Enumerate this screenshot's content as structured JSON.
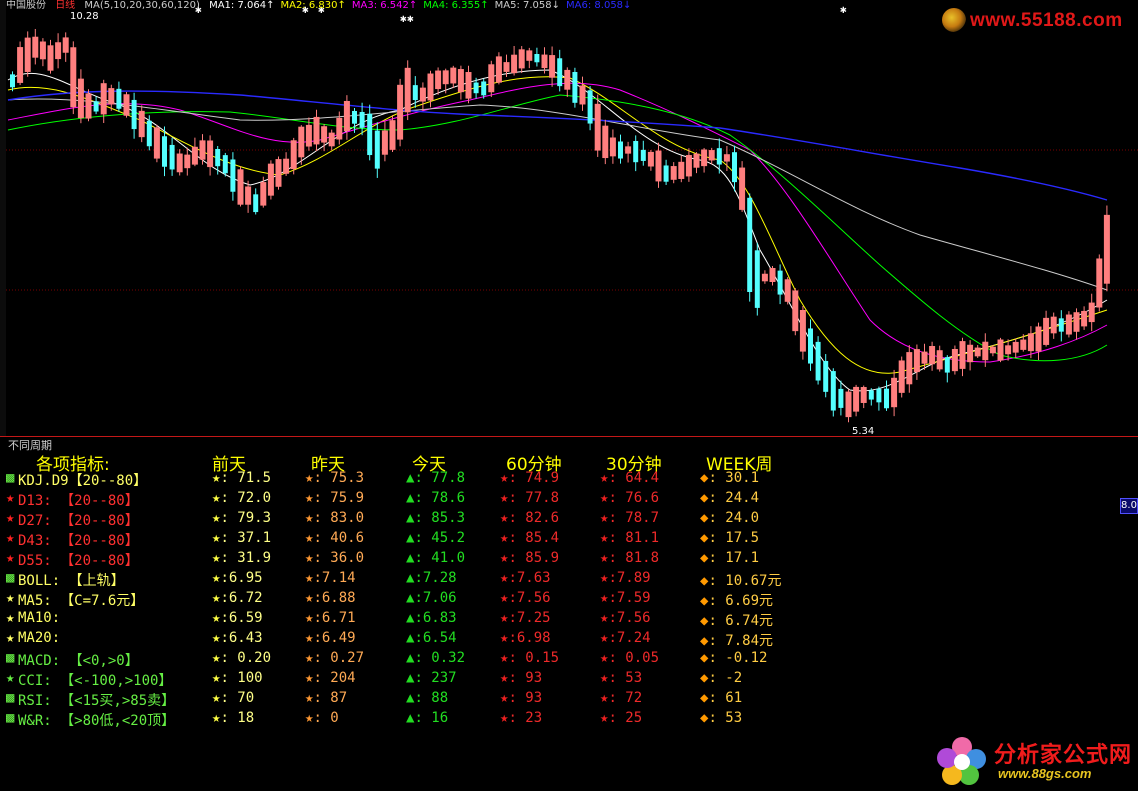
{
  "chart": {
    "stock_name": "中国股份",
    "period": "日线",
    "ma_header": "MA(5,10,20,30,60,120)",
    "ma_values": [
      {
        "label": "MA1: 7.064↑",
        "color": "#ffffff"
      },
      {
        "label": "MA2: 6.830↑",
        "color": "#ffff00"
      },
      {
        "label": "MA3: 6.542↑",
        "color": "#ff00ff"
      },
      {
        "label": "MA4: 6.355↑",
        "color": "#00ff00"
      },
      {
        "label": "MA5: 7.058↓",
        "color": "#cccccc"
      },
      {
        "label": "MA6: 8.058↓",
        "color": "#2a2aff"
      }
    ],
    "high_label": "10.28",
    "low_label": "5.34",
    "colors": {
      "up": "#ff7f7f",
      "down": "#54ffff",
      "grid": "#7a0000"
    }
  },
  "chart_data": {
    "type": "candlestick",
    "ylim": [
      5.0,
      10.5
    ],
    "series": [
      {
        "name": "MA1",
        "color": "#ffffff"
      },
      {
        "name": "MA2",
        "color": "#ffff00"
      },
      {
        "name": "MA3",
        "color": "#ff00ff"
      },
      {
        "name": "MA4",
        "color": "#00ff00"
      },
      {
        "name": "MA5",
        "color": "#cccccc"
      },
      {
        "name": "MA6",
        "color": "#2a2aff"
      }
    ],
    "annotations": [
      "10.28",
      "5.34"
    ]
  },
  "watermarks": {
    "top": "www.55188.com",
    "bottom_cn": "分析家公式网",
    "bottom_url": "www.88gs.com"
  },
  "bottom_pane": {
    "label": "不同周期",
    "axis_tag": "8.0"
  },
  "table": {
    "headers": [
      "各项指标:",
      "前天",
      "昨天",
      "今天",
      "60分钟",
      "30分钟",
      "WEEK周"
    ],
    "rows": [
      {
        "icon": "▩",
        "icon_color": "#66ee44",
        "name": "KDJ.D9【20--80】",
        "name_color": "#ffff66",
        "cells": [
          "★: 71.5",
          "★: 75.3",
          "▲: 77.8",
          "★: 74.9",
          "★: 64.4",
          "◆: 30.1"
        ]
      },
      {
        "icon": "★",
        "icon_color": "#ff2020",
        "name": "D13: 【20--80】",
        "name_color": "#ff3030",
        "cells": [
          "★: 72.0",
          "★: 75.9",
          "▲: 78.6",
          "★: 77.8",
          "★: 76.6",
          "◆: 24.4"
        ]
      },
      {
        "icon": "★",
        "icon_color": "#ff2020",
        "name": "D27: 【20--80】",
        "name_color": "#ff3030",
        "cells": [
          "★: 79.3",
          "★: 83.0",
          "▲: 85.3",
          "★: 82.6",
          "★: 78.7",
          "◆: 24.0"
        ]
      },
      {
        "icon": "★",
        "icon_color": "#ff2020",
        "name": "D43: 【20--80】",
        "name_color": "#ff3030",
        "cells": [
          "★: 37.1",
          "★: 40.6",
          "▲: 45.2",
          "★: 85.4",
          "★: 81.1",
          "◆: 17.5"
        ]
      },
      {
        "icon": "★",
        "icon_color": "#ff2020",
        "name": "D55: 【20--80】",
        "name_color": "#ff3030",
        "cells": [
          "★: 31.9",
          "★: 36.0",
          "▲: 41.0",
          "★: 85.9",
          "★: 81.8",
          "◆: 17.1"
        ]
      },
      {
        "icon": "▩",
        "icon_color": "#66ee44",
        "name": "BOLL: 【上轨】",
        "name_color": "#ffff66",
        "cells": [
          "★:6.95",
          "★:7.14",
          "▲:7.28",
          "★:7.63",
          "★:7.89",
          "◆: 10.67元"
        ]
      },
      {
        "icon": "★",
        "icon_color": "#ffff66",
        "name": "MA5: 【C=7.6元】",
        "name_color": "#ffff66",
        "cells": [
          "★:6.72",
          "★:6.88",
          "▲:7.06",
          "★:7.56",
          "★:7.59",
          "◆: 6.69元"
        ]
      },
      {
        "icon": "★",
        "icon_color": "#ffff66",
        "name": "MA10:",
        "name_color": "#ffff66",
        "cells": [
          "★:6.59",
          "★:6.71",
          "▲:6.83",
          "★:7.25",
          "★:7.56",
          "◆: 6.74元"
        ]
      },
      {
        "icon": "★",
        "icon_color": "#ffff66",
        "name": "MA20:",
        "name_color": "#ffff66",
        "cells": [
          "★:6.43",
          "★:6.49",
          "▲:6.54",
          "★:6.98",
          "★:7.24",
          "◆: 7.84元"
        ]
      },
      {
        "icon": "▩",
        "icon_color": "#66ee44",
        "name": "MACD: 【<0,>0】",
        "name_color": "#66ee44",
        "cells": [
          "★: 0.20",
          "★: 0.27",
          "▲: 0.32",
          "★: 0.15",
          "★: 0.05",
          "◆: -0.12"
        ]
      },
      {
        "icon": "★",
        "icon_color": "#66ee44",
        "name": "CCI: 【<-100,>100】",
        "name_color": "#66ee44",
        "cells": [
          "★: 100",
          "★: 204",
          "▲: 237",
          "★: 93",
          "★: 53",
          "◆: -2"
        ]
      },
      {
        "icon": "▩",
        "icon_color": "#66ee44",
        "name": "RSI: 【<15买,>85卖】",
        "name_color": "#66ee44",
        "cells": [
          "★: 70",
          "★: 87",
          "▲: 88",
          "★: 93",
          "★: 72",
          "◆: 61"
        ]
      },
      {
        "icon": "▩",
        "icon_color": "#66ee44",
        "name": "W&R: 【>80低,<20顶】",
        "name_color": "#66ee44",
        "cells": [
          "★: 18",
          "★: 0",
          "▲: 16",
          "★: 23",
          "★: 25",
          "◆: 53"
        ]
      }
    ],
    "cell_colors": [
      {
        "icon": "#ffff44",
        "text": "#ffff88"
      },
      {
        "icon": "#ff9933",
        "text": "#ffaa55"
      },
      {
        "icon": "#22dd22",
        "text": "#22dd22"
      },
      {
        "icon": "#ee2020",
        "text": "#ee2a2a"
      },
      {
        "icon": "#ee2020",
        "text": "#ee2a2a"
      },
      {
        "icon": "#ff9900",
        "text": "#ffcc44"
      }
    ]
  }
}
